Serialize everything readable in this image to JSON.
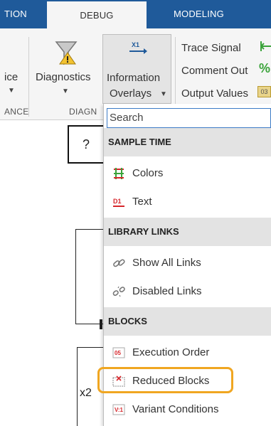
{
  "tabs": [
    {
      "label": "TION"
    },
    {
      "label": "DEBUG",
      "active": true
    },
    {
      "label": "MODELING"
    }
  ],
  "ribbon": {
    "left_partial_label": "ice",
    "diagnostics_label": "Diagnostics",
    "information_overlays_line1": "Information",
    "information_overlays_line2": "Overlays",
    "trace_signal_label": "Trace Signal",
    "comment_out_label": "Comment Out",
    "output_values_label": "Output Values",
    "section_left_label": "ANCE",
    "section_diagnostics_label": "DIAGN"
  },
  "canvas": {
    "question_block": "?",
    "signal_label": "x2"
  },
  "menu": {
    "search_placeholder": "Search",
    "sections": [
      {
        "title": "SAMPLE TIME",
        "items": [
          {
            "label": "Colors",
            "icon": "sample-time-colors-icon"
          },
          {
            "label": "Text",
            "icon": "sample-time-text-icon"
          }
        ]
      },
      {
        "title": "LIBRARY LINKS",
        "items": [
          {
            "label": "Show All Links",
            "icon": "link-icon"
          },
          {
            "label": "Disabled Links",
            "icon": "broken-link-icon"
          }
        ]
      },
      {
        "title": "BLOCKS",
        "items": [
          {
            "label": "Execution Order",
            "icon": "execution-order-icon"
          },
          {
            "label": "Reduced Blocks",
            "icon": "reduced-blocks-icon"
          },
          {
            "label": "Variant Conditions",
            "icon": "variant-conditions-icon"
          }
        ]
      }
    ]
  },
  "colors": {
    "tab_bar": "#1f5a9a",
    "highlight": "#f0a621",
    "accent_red": "#d6262b",
    "accent_green": "#3aa33a"
  }
}
